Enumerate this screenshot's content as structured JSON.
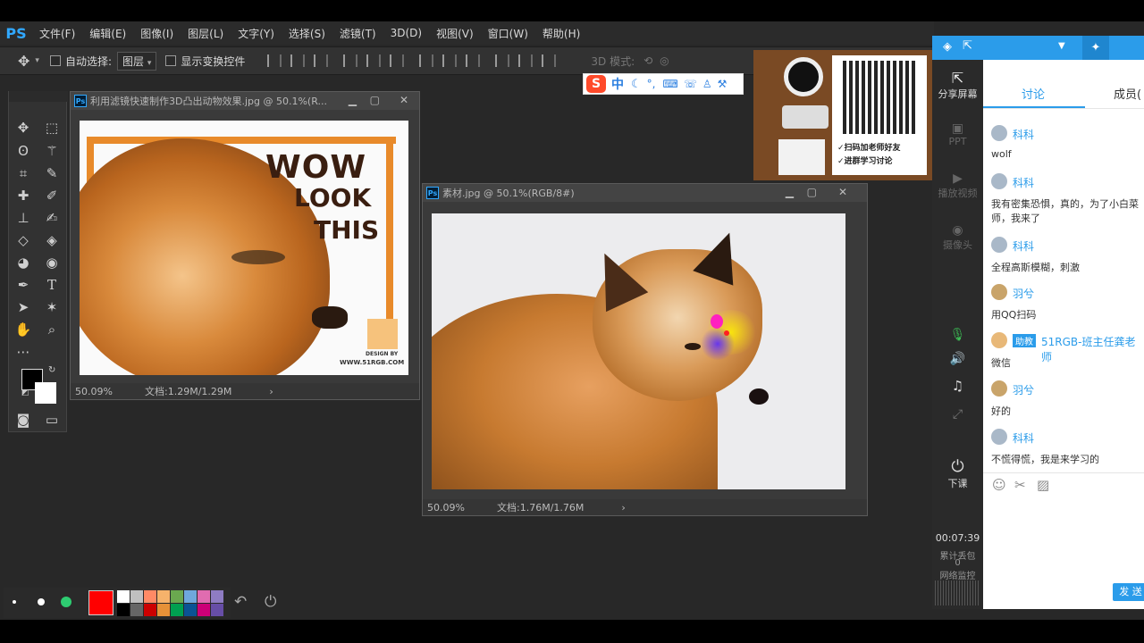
{
  "menubar": {
    "logo": "PS",
    "items": [
      "文件(F)",
      "编辑(E)",
      "图像(I)",
      "图层(L)",
      "文字(Y)",
      "选择(S)",
      "滤镜(T)",
      "3D(D)",
      "视图(V)",
      "窗口(W)",
      "帮助(H)"
    ]
  },
  "options": {
    "auto_select_label": "自动选择:",
    "layer_select": "图层",
    "show_transform_label": "显示变换控件",
    "mode_3d_label": "3D 模式:"
  },
  "doc1": {
    "badge": "Ps",
    "title": "利用滤镜快速制作3D凸出动物效果.jpg @ 50.1%(R...",
    "zoom": "50.09%",
    "docsize": "文档:1.29M/1.29M",
    "poster_line1": "WOW",
    "poster_line2": "LOOK",
    "poster_line3": "THIS",
    "poster_design": "DESIGN BY",
    "poster_url": "WWW.51RGB.COM"
  },
  "doc2": {
    "badge": "Ps",
    "title": "素材.jpg @ 50.1%(RGB/8#)",
    "zoom": "50.09%",
    "docsize": "文档:1.76M/1.76M"
  },
  "ad": {
    "line1": "✓扫码加老师好友",
    "line2": "✓进群学习讨论"
  },
  "ime": {
    "label": "中"
  },
  "qq": {
    "side_items": [
      {
        "icon": "share-screen-icon",
        "label": "分享屏幕"
      },
      {
        "icon": "ppt-icon",
        "label": "PPT"
      },
      {
        "icon": "play-video-icon",
        "label": "播放视频"
      },
      {
        "icon": "camera-icon",
        "label": "摄像头"
      }
    ],
    "end_class": "下课",
    "timer": "00:07:39",
    "lost_label": "累计丢包",
    "lost_value": "0",
    "net_label": "网络监控",
    "tabs": {
      "discuss": "讨论",
      "members": "成员("
    },
    "messages": [
      {
        "name": "",
        "text": "",
        "partial_top": "一"
      },
      {
        "name": "科科",
        "text": "wolf"
      },
      {
        "name": "科科",
        "text": "我有密集恐惧，真的，为了小白菜",
        "text2": "师，我来了"
      },
      {
        "name": "科科",
        "text": "全程高斯模糊，刺激"
      },
      {
        "name": "羽兮",
        "text": "用QQ扫码"
      },
      {
        "name": "51RGB-班主任龚老师",
        "badge": "助教",
        "text": "微信"
      },
      {
        "name": "羽兮",
        "text": "好的"
      },
      {
        "name": "科科",
        "text": "不慌得慌，我是来学习的"
      }
    ],
    "send_button": "发 送"
  },
  "draw_colors": [
    "#ff0000",
    "#ffffff",
    "#c0c0c0",
    "#ff8a65",
    "#f6b26b",
    "#6aa84f",
    "#6fa8dc",
    "#e06cb0",
    "#8e7cc3",
    "#000000",
    "#666666",
    "#cc0000",
    "#e69138",
    "#00a050",
    "#0b5394",
    "#cc0077",
    "#674ea7"
  ]
}
